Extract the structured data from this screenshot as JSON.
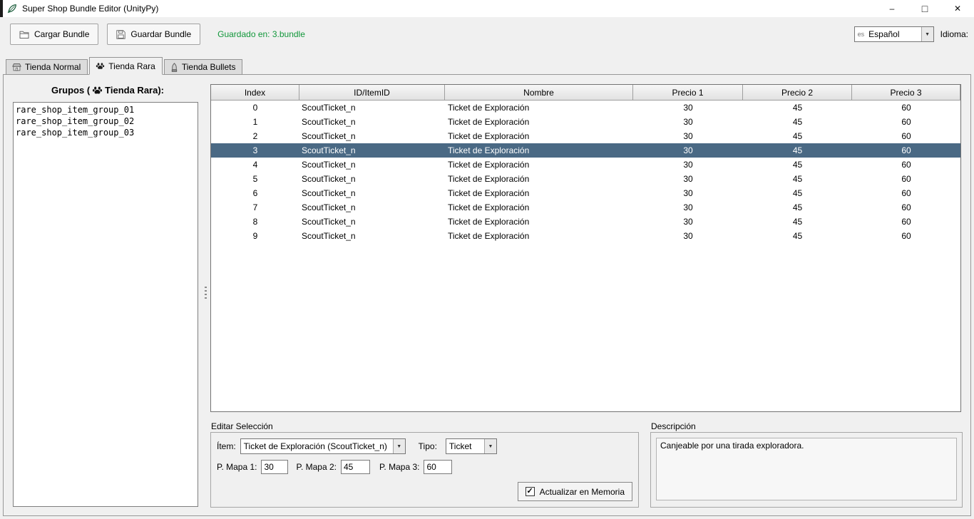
{
  "window": {
    "title": "Super Shop Bundle Editor (UnityPy)"
  },
  "icons": {
    "minimize": "–",
    "maximize": "□",
    "close": "✕",
    "dropdown": "▼",
    "check": "✓"
  },
  "toolbar": {
    "load_button": "Cargar Bundle",
    "save_button": "Guardar Bundle",
    "status_text": "Guardado en: 3.bundle",
    "language_flag": "es",
    "language_value": "Español",
    "language_label": "Idioma:"
  },
  "tabs": [
    {
      "label": "Tienda Normal",
      "selected": false
    },
    {
      "label": "Tienda Rara",
      "selected": true
    },
    {
      "label": "Tienda Bullets",
      "selected": false
    }
  ],
  "groups_panel": {
    "heading_prefix": "Grupos (",
    "heading_suffix": " Tienda Rara):",
    "items": [
      "rare_shop_item_group_01",
      "rare_shop_item_group_02",
      "rare_shop_item_group_03"
    ]
  },
  "table": {
    "columns": [
      "Index",
      "ID/ItemID",
      "Nombre",
      "Precio 1",
      "Precio 2",
      "Precio 3"
    ],
    "selected_row_index": 3,
    "rows": [
      [
        "0",
        "ScoutTicket_n",
        "Ticket de Exploración",
        "30",
        "45",
        "60"
      ],
      [
        "1",
        "ScoutTicket_n",
        "Ticket de Exploración",
        "30",
        "45",
        "60"
      ],
      [
        "2",
        "ScoutTicket_n",
        "Ticket de Exploración",
        "30",
        "45",
        "60"
      ],
      [
        "3",
        "ScoutTicket_n",
        "Ticket de Exploración",
        "30",
        "45",
        "60"
      ],
      [
        "4",
        "ScoutTicket_n",
        "Ticket de Exploración",
        "30",
        "45",
        "60"
      ],
      [
        "5",
        "ScoutTicket_n",
        "Ticket de Exploración",
        "30",
        "45",
        "60"
      ],
      [
        "6",
        "ScoutTicket_n",
        "Ticket de Exploración",
        "30",
        "45",
        "60"
      ],
      [
        "7",
        "ScoutTicket_n",
        "Ticket de Exploración",
        "30",
        "45",
        "60"
      ],
      [
        "8",
        "ScoutTicket_n",
        "Ticket de Exploración",
        "30",
        "45",
        "60"
      ],
      [
        "9",
        "ScoutTicket_n",
        "Ticket de Exploración",
        "30",
        "45",
        "60"
      ]
    ]
  },
  "edit_section": {
    "title": "Editar Selección",
    "item_label": "Ítem:",
    "item_value": "Ticket de Exploración (ScoutTicket_n)",
    "type_label": "Tipo:",
    "type_value": "Ticket",
    "price1_label": "P. Mapa 1:",
    "price1_value": "30",
    "price2_label": "P. Mapa 2:",
    "price2_value": "45",
    "price3_label": "P. Mapa 3:",
    "price3_value": "60",
    "update_checkbox_label": "Actualizar en Memoria",
    "update_checkbox_checked": true
  },
  "description_section": {
    "title": "Descripción",
    "text": "Canjeable por una tirada exploradora."
  },
  "colors": {
    "selection": "#4a6984",
    "status_green": "#11973a"
  }
}
